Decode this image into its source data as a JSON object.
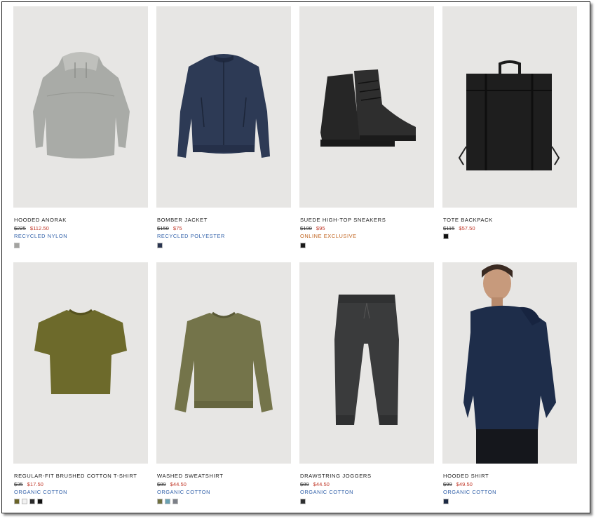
{
  "products": [
    {
      "name": "HOODED ANORAK",
      "old_price": "$225",
      "new_price": "$112.50",
      "tag": "RECYCLED NYLON",
      "tag_color": "#2f5fa8",
      "swatches": [
        "#a3a3a0"
      ],
      "image": "anorak-image"
    },
    {
      "name": "BOMBER JACKET",
      "old_price": "$150",
      "new_price": "$75",
      "tag": "RECYCLED POLYESTER",
      "tag_color": "#2f5fa8",
      "swatches": [
        "#2a3550"
      ],
      "image": "bomber-jacket-image"
    },
    {
      "name": "SUEDE HIGH-TOP SNEAKERS",
      "old_price": "$190",
      "new_price": "$95",
      "tag": "ONLINE EXCLUSIVE",
      "tag_color": "#c0631e",
      "swatches": [
        "#1a1a1a"
      ],
      "image": "sneakers-image"
    },
    {
      "name": "TOTE BACKPACK",
      "old_price": "$115",
      "new_price": "$57.50",
      "tag": "",
      "tag_color": "#2f5fa8",
      "swatches": [
        "#111111"
      ],
      "image": "backpack-image"
    },
    {
      "name": "REGULAR-FIT BRUSHED COTTON T-SHIRT",
      "old_price": "$35",
      "new_price": "$17.50",
      "tag": "ORGANIC COTTON",
      "tag_color": "#2f5fa8",
      "swatches": [
        "#6a6428",
        "#f2f2f2",
        "#2a2a2a",
        "#111111"
      ],
      "image": "tshirt-image"
    },
    {
      "name": "WASHED SWEATSHIRT",
      "old_price": "$89",
      "new_price": "$44.50",
      "tag": "ORGANIC COTTON",
      "tag_color": "#2f5fa8",
      "swatches": [
        "#6f7040",
        "#6aa2b4",
        "#7c8088"
      ],
      "image": "sweatshirt-image"
    },
    {
      "name": "DRAWSTRING JOGGERS",
      "old_price": "$89",
      "new_price": "$44.50",
      "tag": "ORGANIC COTTON",
      "tag_color": "#2f5fa8",
      "swatches": [
        "#2e2f30"
      ],
      "image": "joggers-image"
    },
    {
      "name": "HOODED SHIRT",
      "old_price": "$99",
      "new_price": "$49.50",
      "tag": "ORGANIC COTTON",
      "tag_color": "#2f5fa8",
      "swatches": [
        "#1c2a44"
      ],
      "image": "hooded-shirt-image"
    }
  ]
}
